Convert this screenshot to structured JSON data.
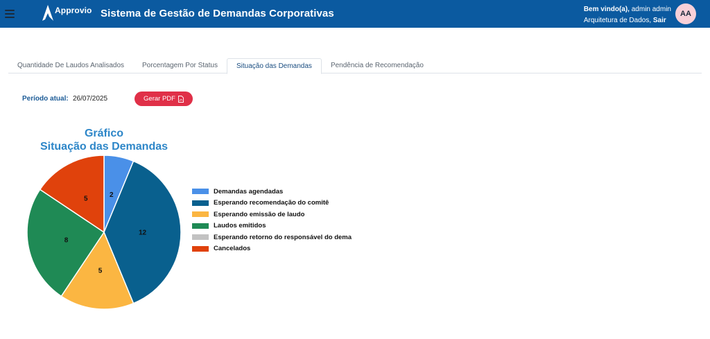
{
  "header": {
    "logo_text": "Approvio",
    "title": "Sistema de Gestão de Demandas Corporativas",
    "welcome_label": "Bem vindo(a),",
    "user_name": "admin admin",
    "department": "Arquitetura de Dados,",
    "logout_label": "Sair",
    "avatar_initials": "AA"
  },
  "tabs": [
    {
      "label": "Quantidade De Laudos Analisados"
    },
    {
      "label": "Porcentagem Por Status"
    },
    {
      "label": "Situação das Demandas"
    },
    {
      "label": "Pendência de Recomendação"
    }
  ],
  "active_tab": 2,
  "periodo": {
    "label": "Período atual:",
    "value": "26/07/2025"
  },
  "pdf_button": {
    "label": "Gerar PDF",
    "icon": "pdf-file-icon"
  },
  "chart_data": {
    "type": "pie",
    "title_line1": "Gráfico",
    "title_line2": "Situação das Demandas",
    "legend_position": "right",
    "series": [
      {
        "name": "Demandas agendadas",
        "value": 2,
        "color": "#4a90e8"
      },
      {
        "name": "Esperando recomendação do comitê",
        "value": 12,
        "color": "#09608e"
      },
      {
        "name": "Esperando emissão de laudo",
        "value": 5,
        "color": "#fbb642"
      },
      {
        "name": "Laudos emitidos",
        "value": 8,
        "color": "#1f8a55"
      },
      {
        "name": "Esperando retorno do responsável do dema",
        "value": 0,
        "color": "#c2c2c2"
      },
      {
        "name": "Cancelados",
        "value": 5,
        "color": "#e0420c"
      }
    ]
  }
}
